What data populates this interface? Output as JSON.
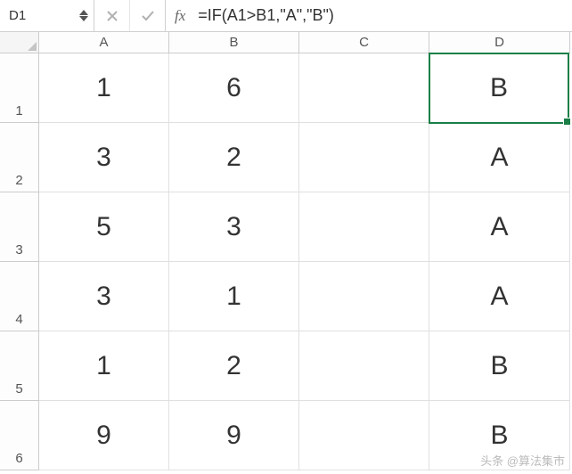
{
  "nameBox": {
    "value": "D1"
  },
  "formulaBar": {
    "fxLabel": "fx",
    "formula": "=IF(A1>B1,\"A\",\"B\")"
  },
  "columns": [
    "A",
    "B",
    "C",
    "D"
  ],
  "rowNumbers": [
    "1",
    "2",
    "3",
    "4",
    "5",
    "6"
  ],
  "cells": {
    "r1": {
      "A": "1",
      "B": "6",
      "C": "",
      "D": "B"
    },
    "r2": {
      "A": "3",
      "B": "2",
      "C": "",
      "D": "A"
    },
    "r3": {
      "A": "5",
      "B": "3",
      "C": "",
      "D": "A"
    },
    "r4": {
      "A": "3",
      "B": "1",
      "C": "",
      "D": "A"
    },
    "r5": {
      "A": "1",
      "B": "2",
      "C": "",
      "D": "B"
    },
    "r6": {
      "A": "9",
      "B": "9",
      "C": "",
      "D": "B"
    }
  },
  "selectedCell": "D1",
  "watermark": "头条 @算法集市"
}
